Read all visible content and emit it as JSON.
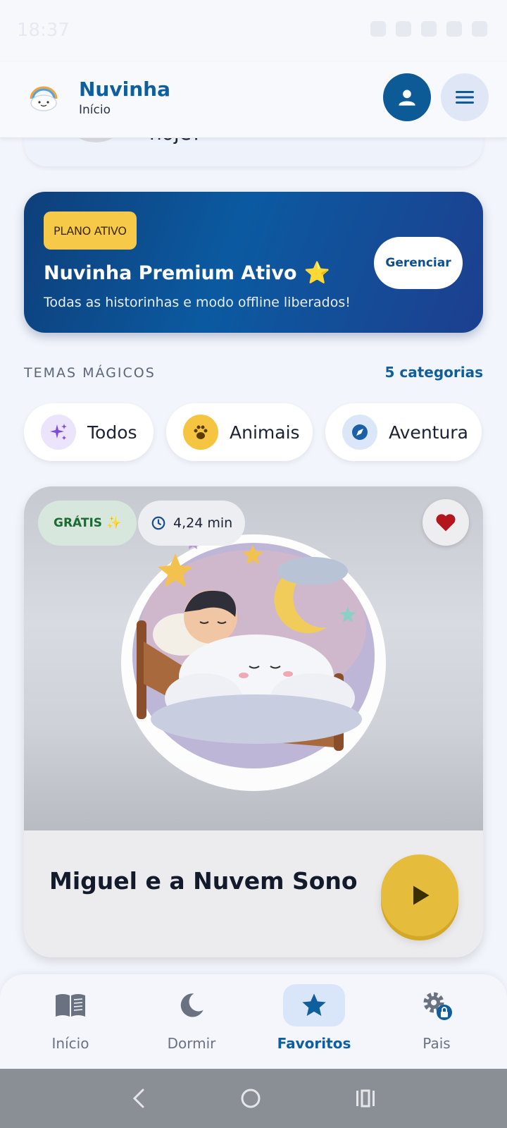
{
  "status_bar": {
    "time": "18:37"
  },
  "header": {
    "app_name": "Nuvinha",
    "subtitle": "Início"
  },
  "previous_card": {
    "text": "hoje?"
  },
  "premium": {
    "badge": "PLANO ATIVO",
    "title": "Nuvinha Premium Ativo",
    "title_emoji": "⭐",
    "subtitle": "Todas as historinhas e modo offline liberados!",
    "button": "Gerenciar"
  },
  "themes": {
    "label": "TEMAS MÁGICOS",
    "count_link": "5 categorias",
    "chips": [
      {
        "label": "Todos",
        "icon": "sparkles-icon",
        "color": "#7c4ddb",
        "bg": "#ece4fb"
      },
      {
        "label": "Animais",
        "icon": "paw-icon",
        "color": "#5a3b00",
        "bg": "#f5c542"
      },
      {
        "label": "Aventura",
        "icon": "compass-icon",
        "color": "#1a5fa8",
        "bg": "#dbe7f9"
      }
    ]
  },
  "story": {
    "badge_free": "GRÁTIS ✨",
    "duration": "4,24 min",
    "title": "Miguel e a Nuvem Sonole...",
    "favorite": true
  },
  "bottom_nav": {
    "items": [
      {
        "label": "Início",
        "icon": "book-icon"
      },
      {
        "label": "Dormir",
        "icon": "moon-icon"
      },
      {
        "label": "Favoritos",
        "icon": "star-icon"
      },
      {
        "label": "Pais",
        "icon": "gear-lock-icon"
      }
    ],
    "active": "Favoritos"
  },
  "colors": {
    "brand": "#0f5f9e",
    "accent_yellow": "#f7c948",
    "play_button": "#e6bc3c",
    "heart": "#b3161c"
  }
}
